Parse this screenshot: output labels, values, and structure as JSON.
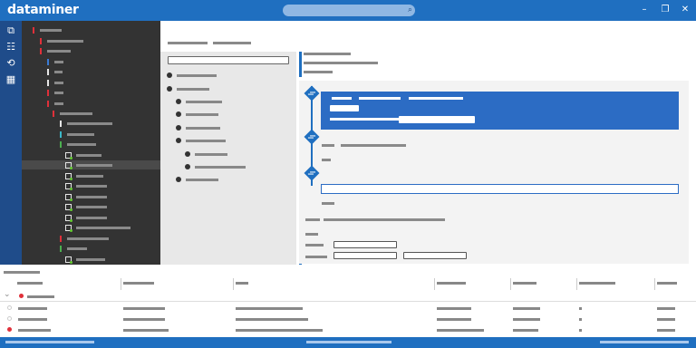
{
  "app": {
    "brand": "dataminer",
    "search_icon": "search-icon",
    "window_controls": [
      "minimize-icon",
      "restore-icon",
      "close-icon"
    ],
    "window_glyphs": {
      "minimize": "–",
      "restore": "❐",
      "close": "✕"
    }
  },
  "rail": {
    "icons": [
      "surveyor-icon",
      "topology-icon",
      "history-icon",
      "apps-icon"
    ],
    "glyphs": [
      "⧉",
      "☷",
      "⟲",
      "▦"
    ]
  },
  "tree": {
    "marker_colors": {
      "red": "#e0303a",
      "blue": "#3a7bd5",
      "white": "#e6e6e6",
      "teal": "#3cb8c8",
      "green": "#4caf50"
    },
    "selected_row_color": "#4a4a4a"
  },
  "colors": {
    "accent": "#1f6fc0",
    "rail": "#1f4c8a",
    "tree_bg": "#333333",
    "flow_bg": "#f3f3f3",
    "highlight_box": "#2c6cc4",
    "alarm_red": "#e0303a"
  },
  "main": {
    "search_input_value": ""
  },
  "table": {
    "group_expand_icon": "chevron-down-icon",
    "row_status": [
      "empty-circle-icon",
      "empty-circle-icon",
      "red-dot-icon"
    ]
  }
}
